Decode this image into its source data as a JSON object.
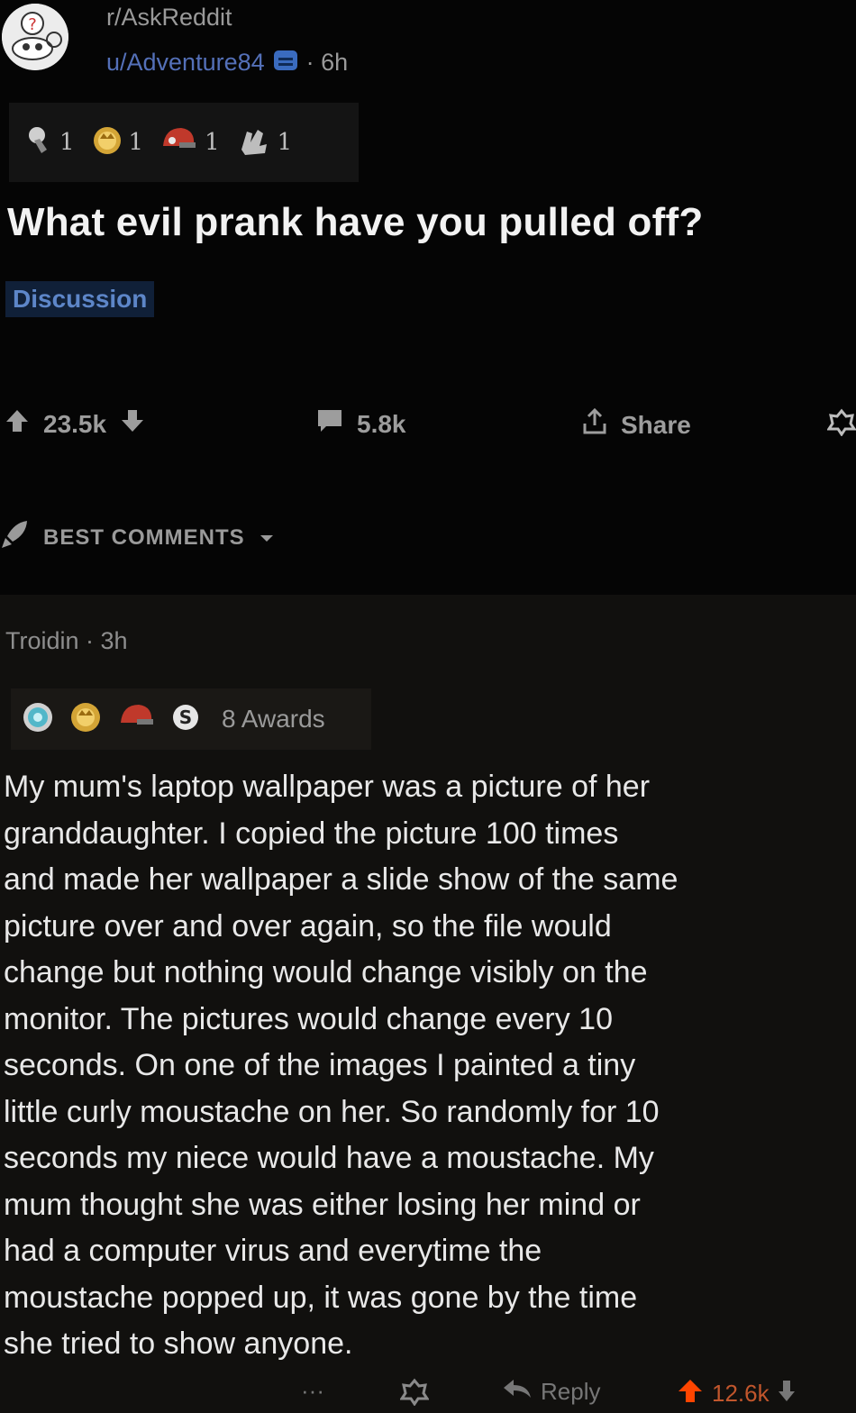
{
  "post": {
    "subreddit": "r/AskReddit",
    "username": "u/Adventure84",
    "time": "· 6h",
    "awards": [
      {
        "icon": "silver-award-icon",
        "count": "1"
      },
      {
        "icon": "gold-award-icon",
        "count": "1"
      },
      {
        "icon": "helmet-award-icon",
        "count": "1"
      },
      {
        "icon": "helpful-hands-award-icon",
        "count": "1"
      }
    ],
    "title": "What evil prank have you pulled off?",
    "flair": "Discussion",
    "votes": "23.5k",
    "comments_count": "5.8k",
    "share_label": "Share"
  },
  "sort": {
    "label": "BEST COMMENTS"
  },
  "comment": {
    "author": "Troidin · 3h",
    "awards_label": "8 Awards",
    "body_lines": [
      "My mum's laptop wallpaper was a picture of her",
      "granddaughter. I copied the picture 100 times",
      "and made her wallpaper a slide show of the same",
      "picture over and over again, so the file would",
      "change but nothing would change visibly on the",
      "monitor. The pictures would change every 10",
      "seconds. On one of the images I painted a tiny",
      "little curly moustache on her. So randomly for 10",
      "seconds my niece would have a moustache. My",
      "mum thought she was either losing her mind or",
      "had a computer virus and everytime the",
      "moustache popped up, it was gone by the time",
      "she tried to show anyone."
    ],
    "more_label": "···",
    "reply_label": "Reply",
    "votes": "12.6k"
  },
  "colors": {
    "background": "#060606",
    "upvote_active": "#ff4500",
    "username": "#5470b8",
    "flair_text": "#5d86c8"
  }
}
